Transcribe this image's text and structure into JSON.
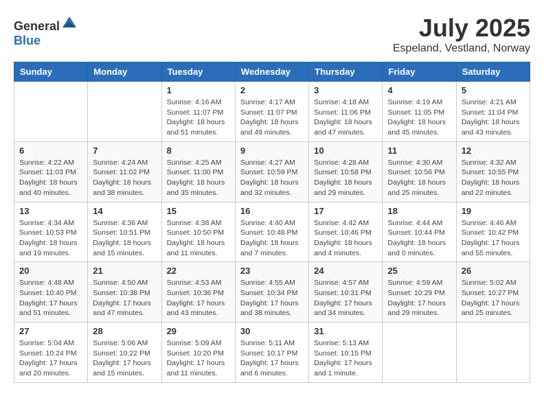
{
  "logo": {
    "text_general": "General",
    "text_blue": "Blue"
  },
  "header": {
    "month": "July 2025",
    "location": "Espeland, Vestland, Norway"
  },
  "weekdays": [
    "Sunday",
    "Monday",
    "Tuesday",
    "Wednesday",
    "Thursday",
    "Friday",
    "Saturday"
  ],
  "weeks": [
    [
      {
        "day": "",
        "sunrise": "",
        "sunset": "",
        "daylight": ""
      },
      {
        "day": "",
        "sunrise": "",
        "sunset": "",
        "daylight": ""
      },
      {
        "day": "1",
        "sunrise": "Sunrise: 4:16 AM",
        "sunset": "Sunset: 11:07 PM",
        "daylight": "Daylight: 18 hours and 51 minutes."
      },
      {
        "day": "2",
        "sunrise": "Sunrise: 4:17 AM",
        "sunset": "Sunset: 11:07 PM",
        "daylight": "Daylight: 18 hours and 49 minutes."
      },
      {
        "day": "3",
        "sunrise": "Sunrise: 4:18 AM",
        "sunset": "Sunset: 11:06 PM",
        "daylight": "Daylight: 18 hours and 47 minutes."
      },
      {
        "day": "4",
        "sunrise": "Sunrise: 4:19 AM",
        "sunset": "Sunset: 11:05 PM",
        "daylight": "Daylight: 18 hours and 45 minutes."
      },
      {
        "day": "5",
        "sunrise": "Sunrise: 4:21 AM",
        "sunset": "Sunset: 11:04 PM",
        "daylight": "Daylight: 18 hours and 43 minutes."
      }
    ],
    [
      {
        "day": "6",
        "sunrise": "Sunrise: 4:22 AM",
        "sunset": "Sunset: 11:03 PM",
        "daylight": "Daylight: 18 hours and 40 minutes."
      },
      {
        "day": "7",
        "sunrise": "Sunrise: 4:24 AM",
        "sunset": "Sunset: 11:02 PM",
        "daylight": "Daylight: 18 hours and 38 minutes."
      },
      {
        "day": "8",
        "sunrise": "Sunrise: 4:25 AM",
        "sunset": "Sunset: 11:00 PM",
        "daylight": "Daylight: 18 hours and 35 minutes."
      },
      {
        "day": "9",
        "sunrise": "Sunrise: 4:27 AM",
        "sunset": "Sunset: 10:59 PM",
        "daylight": "Daylight: 18 hours and 32 minutes."
      },
      {
        "day": "10",
        "sunrise": "Sunrise: 4:28 AM",
        "sunset": "Sunset: 10:58 PM",
        "daylight": "Daylight: 18 hours and 29 minutes."
      },
      {
        "day": "11",
        "sunrise": "Sunrise: 4:30 AM",
        "sunset": "Sunset: 10:56 PM",
        "daylight": "Daylight: 18 hours and 25 minutes."
      },
      {
        "day": "12",
        "sunrise": "Sunrise: 4:32 AM",
        "sunset": "Sunset: 10:55 PM",
        "daylight": "Daylight: 18 hours and 22 minutes."
      }
    ],
    [
      {
        "day": "13",
        "sunrise": "Sunrise: 4:34 AM",
        "sunset": "Sunset: 10:53 PM",
        "daylight": "Daylight: 18 hours and 19 minutes."
      },
      {
        "day": "14",
        "sunrise": "Sunrise: 4:36 AM",
        "sunset": "Sunset: 10:51 PM",
        "daylight": "Daylight: 18 hours and 15 minutes."
      },
      {
        "day": "15",
        "sunrise": "Sunrise: 4:38 AM",
        "sunset": "Sunset: 10:50 PM",
        "daylight": "Daylight: 18 hours and 11 minutes."
      },
      {
        "day": "16",
        "sunrise": "Sunrise: 4:40 AM",
        "sunset": "Sunset: 10:48 PM",
        "daylight": "Daylight: 18 hours and 7 minutes."
      },
      {
        "day": "17",
        "sunrise": "Sunrise: 4:42 AM",
        "sunset": "Sunset: 10:46 PM",
        "daylight": "Daylight: 18 hours and 4 minutes."
      },
      {
        "day": "18",
        "sunrise": "Sunrise: 4:44 AM",
        "sunset": "Sunset: 10:44 PM",
        "daylight": "Daylight: 18 hours and 0 minutes."
      },
      {
        "day": "19",
        "sunrise": "Sunrise: 4:46 AM",
        "sunset": "Sunset: 10:42 PM",
        "daylight": "Daylight: 17 hours and 55 minutes."
      }
    ],
    [
      {
        "day": "20",
        "sunrise": "Sunrise: 4:48 AM",
        "sunset": "Sunset: 10:40 PM",
        "daylight": "Daylight: 17 hours and 51 minutes."
      },
      {
        "day": "21",
        "sunrise": "Sunrise: 4:50 AM",
        "sunset": "Sunset: 10:38 PM",
        "daylight": "Daylight: 17 hours and 47 minutes."
      },
      {
        "day": "22",
        "sunrise": "Sunrise: 4:53 AM",
        "sunset": "Sunset: 10:36 PM",
        "daylight": "Daylight: 17 hours and 43 minutes."
      },
      {
        "day": "23",
        "sunrise": "Sunrise: 4:55 AM",
        "sunset": "Sunset: 10:34 PM",
        "daylight": "Daylight: 17 hours and 38 minutes."
      },
      {
        "day": "24",
        "sunrise": "Sunrise: 4:57 AM",
        "sunset": "Sunset: 10:31 PM",
        "daylight": "Daylight: 17 hours and 34 minutes."
      },
      {
        "day": "25",
        "sunrise": "Sunrise: 4:59 AM",
        "sunset": "Sunset: 10:29 PM",
        "daylight": "Daylight: 17 hours and 29 minutes."
      },
      {
        "day": "26",
        "sunrise": "Sunrise: 5:02 AM",
        "sunset": "Sunset: 10:27 PM",
        "daylight": "Daylight: 17 hours and 25 minutes."
      }
    ],
    [
      {
        "day": "27",
        "sunrise": "Sunrise: 5:04 AM",
        "sunset": "Sunset: 10:24 PM",
        "daylight": "Daylight: 17 hours and 20 minutes."
      },
      {
        "day": "28",
        "sunrise": "Sunrise: 5:06 AM",
        "sunset": "Sunset: 10:22 PM",
        "daylight": "Daylight: 17 hours and 15 minutes."
      },
      {
        "day": "29",
        "sunrise": "Sunrise: 5:09 AM",
        "sunset": "Sunset: 10:20 PM",
        "daylight": "Daylight: 17 hours and 11 minutes."
      },
      {
        "day": "30",
        "sunrise": "Sunrise: 5:11 AM",
        "sunset": "Sunset: 10:17 PM",
        "daylight": "Daylight: 17 hours and 6 minutes."
      },
      {
        "day": "31",
        "sunrise": "Sunrise: 5:13 AM",
        "sunset": "Sunset: 10:15 PM",
        "daylight": "Daylight: 17 hours and 1 minute."
      },
      {
        "day": "",
        "sunrise": "",
        "sunset": "",
        "daylight": ""
      },
      {
        "day": "",
        "sunrise": "",
        "sunset": "",
        "daylight": ""
      }
    ]
  ]
}
